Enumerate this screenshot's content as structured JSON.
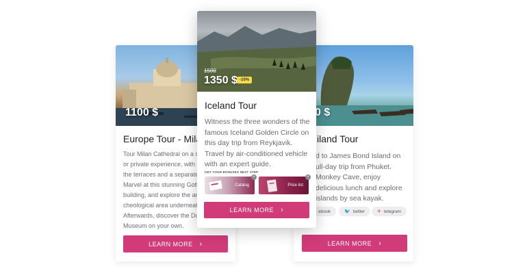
{
  "cards": {
    "left": {
      "price": "1100 $",
      "title": "Europe Tour - Mila",
      "desc_lines": [
        "Tour Milan Cathedral on a s",
        "or private experience, with ",
        "the terraces and a separate",
        "Marvel at this stunning Goth",
        "building, and explore the ar",
        "cheological area underneat",
        "Afterwards, discover the Du",
        "Museum on your own."
      ],
      "button": "LEARN MORE"
    },
    "center": {
      "old_price": "1500",
      "price": "1350 $",
      "discount": "-10%",
      "title": "Iceland Tour",
      "desc_lines": [
        "Witness the three wonders of the",
        "famous Iceland Golden Circle on",
        "this day trip from Reykjavik.",
        "Travel by air-conditioned vehicle",
        "with an expert guide."
      ],
      "bonus_label": "GET YOUR BONUSES NEXT STEP",
      "bonus_items": [
        "Catalog",
        "Price list"
      ],
      "button": "LEARN MORE"
    },
    "right": {
      "price": "0 $",
      "title": "iland Tour",
      "desc_lines": [
        "d to James Bond Island on",
        "ull-day trip from Phuket.",
        " Monkey Cave, enjoy",
        "delicious lunch and explore",
        "islands by sea kayak."
      ],
      "socials": [
        "ebook",
        "twitter",
        "telegram"
      ],
      "button": "LEARN MORE"
    }
  },
  "colors": {
    "accent": "#d13b78"
  },
  "icons": {
    "chevron": "›",
    "twitter": "🐦",
    "telegram": "✈"
  }
}
